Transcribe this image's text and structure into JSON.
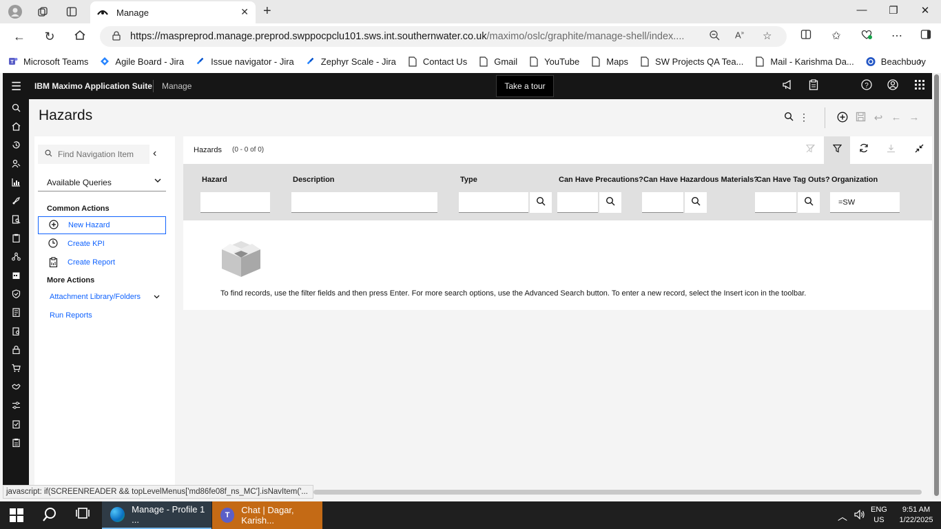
{
  "browser": {
    "tab_title": "Manage",
    "url_host": "https://maspreprod.manage.preprod.swppocpclu101.sws.int.southernwater.co.uk",
    "url_path": "/maximo/oslc/graphite/manage-shell/index....",
    "bookmarks": [
      {
        "label": "Microsoft Teams",
        "icon": "teams-icon",
        "color": "#5b5fc7"
      },
      {
        "label": "Agile Board - Jira",
        "icon": "jira-icon",
        "color": "#2684ff"
      },
      {
        "label": "Issue navigator - Jira",
        "icon": "jira-icon",
        "color": "#2684ff"
      },
      {
        "label": "Zephyr Scale - Jira",
        "icon": "jira-icon",
        "color": "#2684ff"
      },
      {
        "label": "Contact Us",
        "icon": "page-icon",
        "color": "#333333"
      },
      {
        "label": "Gmail",
        "icon": "page-icon",
        "color": "#333333"
      },
      {
        "label": "YouTube",
        "icon": "page-icon",
        "color": "#333333"
      },
      {
        "label": "Maps",
        "icon": "page-icon",
        "color": "#333333"
      },
      {
        "label": "SW Projects QA Tea...",
        "icon": "page-icon",
        "color": "#333333"
      },
      {
        "label": "Mail - Karishma Da...",
        "icon": "page-icon",
        "color": "#333333"
      },
      {
        "label": "Beachbuoy",
        "icon": "globe-icon",
        "color": "#2457c5"
      }
    ]
  },
  "header": {
    "brand": "IBM Maximo Application Suite",
    "app_name": "Manage",
    "tour_label": "Take a tour"
  },
  "page": {
    "title": "Hazards"
  },
  "nav": {
    "search_placeholder": "Find Navigation Item",
    "queries_label": "Available Queries",
    "common_actions_head": "Common Actions",
    "common_actions": [
      {
        "label": "New Hazard",
        "icon": "add-icon"
      },
      {
        "label": "Create KPI",
        "icon": "clock-icon"
      },
      {
        "label": "Create Report",
        "icon": "report-icon"
      }
    ],
    "more_actions_head": "More Actions",
    "more_actions": [
      {
        "label": "Attachment Library/Folders"
      },
      {
        "label": "Run Reports"
      }
    ]
  },
  "grid": {
    "title": "Hazards",
    "count": "(0 - 0 of 0)",
    "columns": [
      {
        "label": "Hazard",
        "value": ""
      },
      {
        "label": "Description",
        "value": ""
      },
      {
        "label": "Type",
        "value": ""
      },
      {
        "label": "Can Have Precautions?",
        "value": ""
      },
      {
        "label": "Can Have Hazardous Materials?",
        "value": ""
      },
      {
        "label": "Can Have Tag Outs?",
        "value": ""
      },
      {
        "label": "Organization",
        "value": "=SW"
      }
    ],
    "empty_message": "To find records, use the filter fields and then press Enter. For more search options, use the Advanced Search button. To enter a new record, select the Insert icon in the toolbar."
  },
  "status_bar": {
    "text": "javascript: if(SCREENREADER && topLevelMenus['md86fe08f_ns_MC'].isNavItem('..."
  },
  "taskbar": {
    "tasks": [
      {
        "label": "Manage - Profile 1 ...",
        "icon": "edge-icon"
      },
      {
        "label": "Chat | Dagar, Karish...",
        "icon": "teams-icon"
      }
    ],
    "lang_top": "ENG",
    "lang_bottom": "US",
    "time": "9:51 AM",
    "date": "1/22/2025"
  },
  "colors": {
    "accent": "#0f62fe",
    "header_bg": "#161616",
    "filter_row_bg": "#e0e0e0"
  }
}
